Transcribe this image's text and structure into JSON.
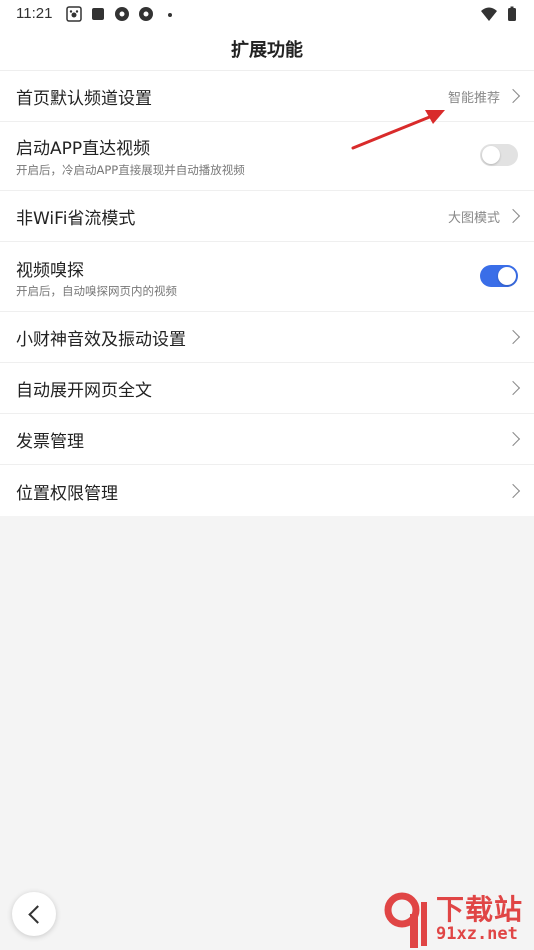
{
  "status": {
    "time": "11:21"
  },
  "header": {
    "title": "扩展功能"
  },
  "rows": [
    {
      "label": "首页默认频道设置",
      "value": "智能推荐"
    },
    {
      "label": "启动APP直达视频",
      "sub": "开启后，冷启动APP直接展现并自动播放视频",
      "toggle": "off"
    },
    {
      "label": "非WiFi省流模式",
      "value": "大图模式"
    },
    {
      "label": "视频嗅探",
      "sub": "开启后，自动嗅探网页内的视频",
      "toggle": "on"
    },
    {
      "label": "小财神音效及振动设置"
    },
    {
      "label": "自动展开网页全文"
    },
    {
      "label": "发票管理"
    },
    {
      "label": "位置权限管理"
    }
  ],
  "watermark": {
    "line1": "下载站",
    "line2": "91xz.net"
  },
  "colors": {
    "toggle_on": "#3a6ee8",
    "annotation_arrow": "#d92b2b",
    "watermark": "#e04545"
  }
}
